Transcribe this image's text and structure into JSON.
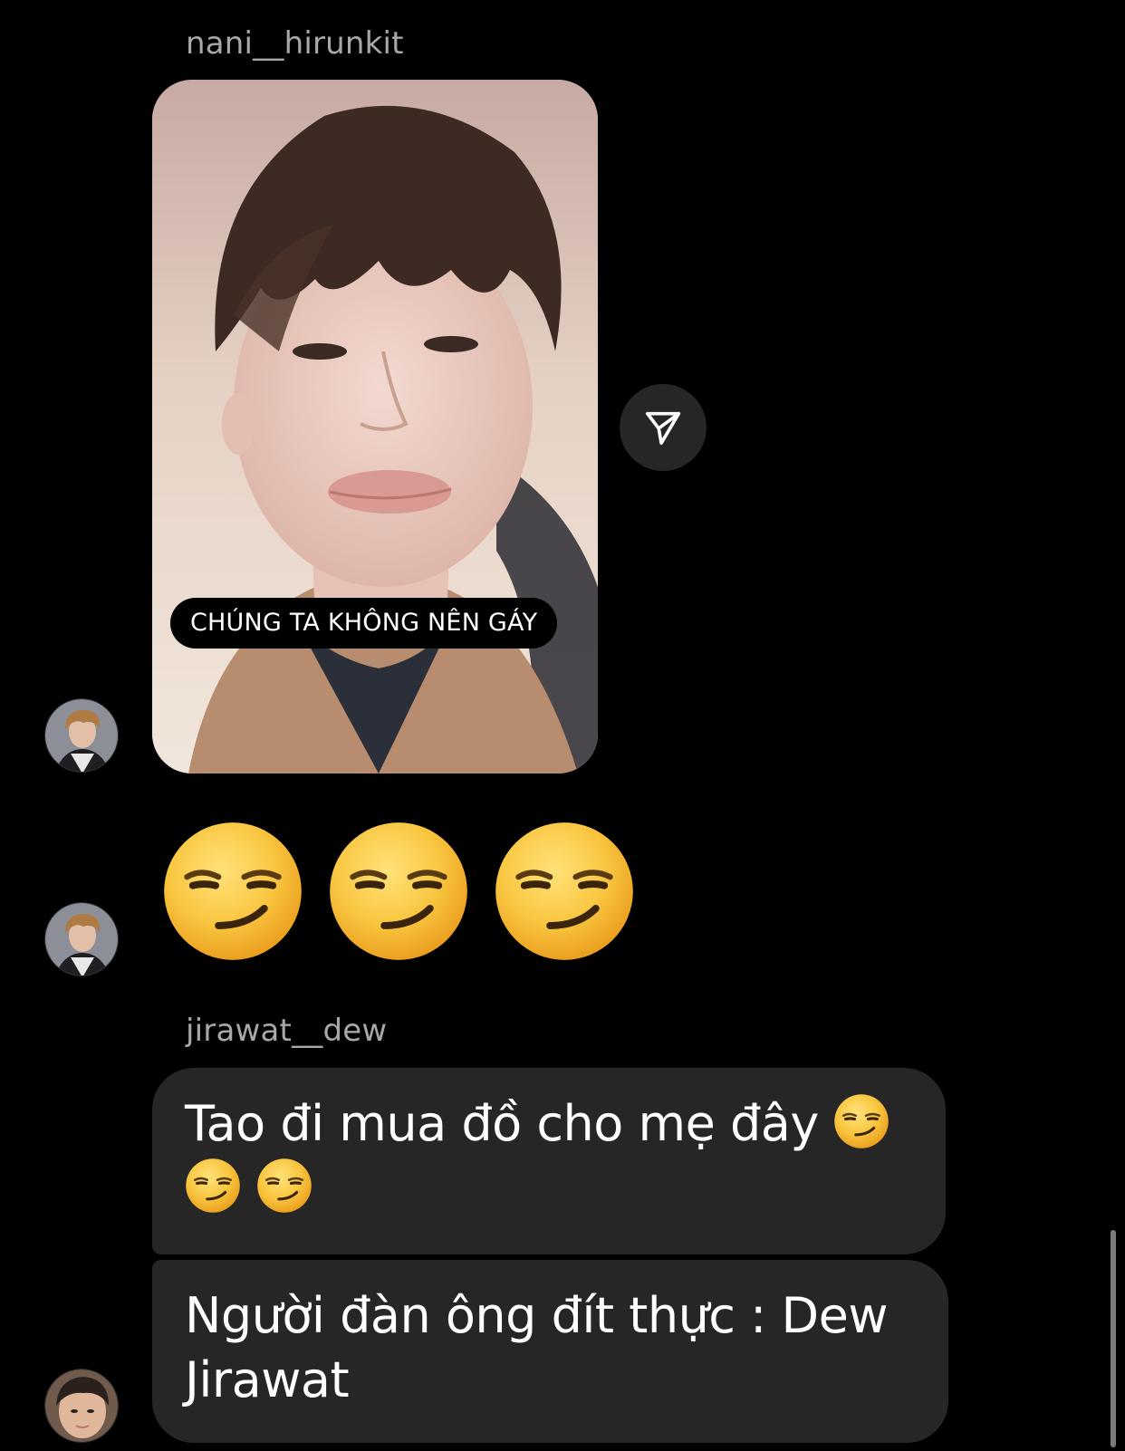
{
  "thread": {
    "story_reply": {
      "sender_name": "nani__hirunkit",
      "caption": "CHÚNG TA KHÔNG NÊN GÁY"
    },
    "big_emoji_message": {
      "emojis": [
        "smirking-face",
        "smirking-face",
        "smirking-face"
      ]
    },
    "text_messages": {
      "sender_name": "jirawat__dew",
      "messages": [
        {
          "text": "Tao đi mua đồ cho mẹ đây",
          "trailing_emojis": [
            "smirking-face",
            "smirking-face",
            "smirking-face"
          ]
        },
        {
          "text": "Người đàn ông đít thực : Dew Jirawat"
        }
      ]
    }
  },
  "colors": {
    "background": "#000000",
    "bubble": "#262626",
    "sender_name": "#a8a8a8",
    "emoji_yellow": "#f7c84a"
  },
  "icons": {
    "share": "paper-plane-icon"
  }
}
